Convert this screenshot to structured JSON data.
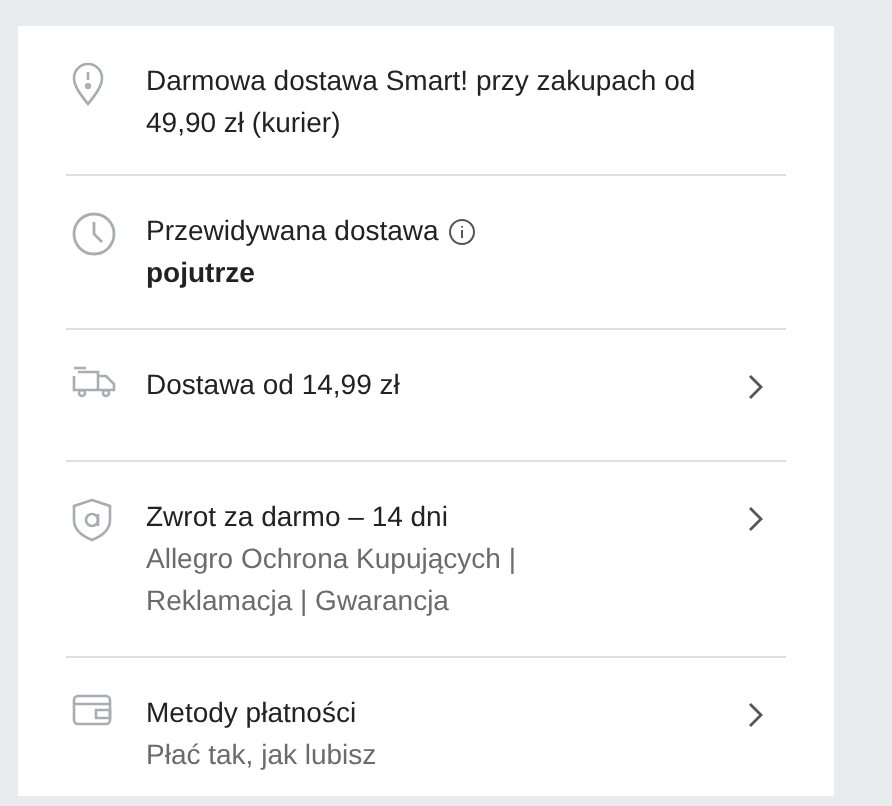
{
  "rows": [
    {
      "kind": "pin",
      "title": "Darmowa dostawa Smart! przy zakupach od 49,90 zł (kurier)",
      "info_icon": false,
      "link": false
    },
    {
      "kind": "clock",
      "title": "Przewidywana dostawa",
      "info_icon": true,
      "subtitle": "pojutrze",
      "subtitle_bold": true,
      "link": false
    },
    {
      "kind": "truck",
      "title": "Dostawa od 14,99 zł",
      "info_icon": false,
      "link": true
    },
    {
      "kind": "shield",
      "title": "Zwrot za darmo – 14 dni",
      "info_icon": false,
      "subtitle": "Allegro Ochrona Kupujących | Reklamacja | Gwarancja",
      "subtitle_bold": false,
      "link": true
    },
    {
      "kind": "wallet",
      "title": "Metody płatności",
      "info_icon": false,
      "subtitle": "Płać tak, jak lubisz",
      "subtitle_bold": false,
      "link": true
    }
  ]
}
